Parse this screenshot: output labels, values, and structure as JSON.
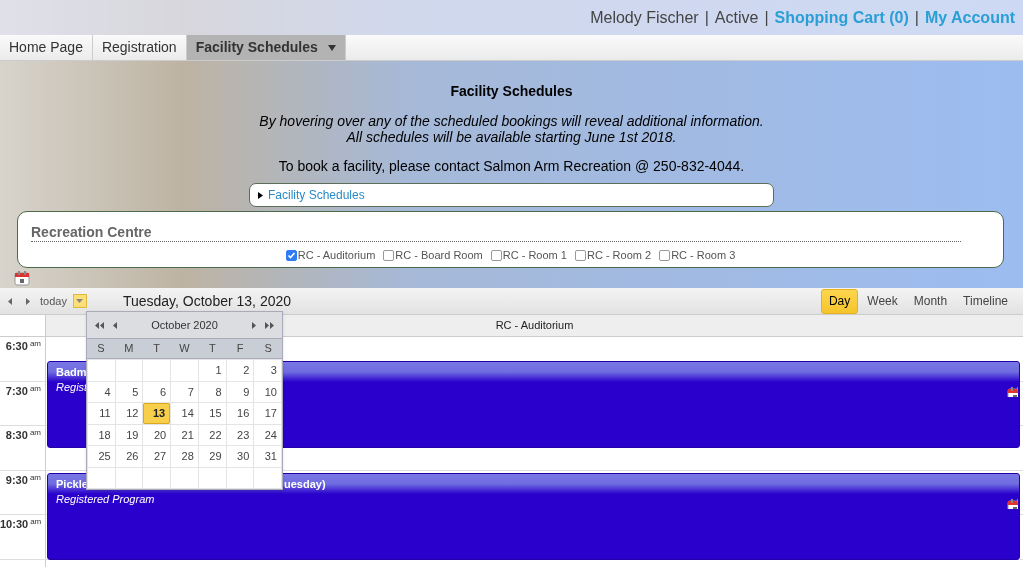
{
  "user_bar": {
    "name": "Melody Fischer",
    "status": "Active",
    "cart": "Shopping Cart (0)",
    "account": "My Account",
    "separator": "|"
  },
  "nav": [
    {
      "label": "Home Page",
      "selected": false,
      "dropdown": false
    },
    {
      "label": "Registration",
      "selected": false,
      "dropdown": false
    },
    {
      "label": "Facility Schedules",
      "selected": true,
      "dropdown": true
    }
  ],
  "intro": {
    "title": "Facility Schedules",
    "notes": [
      "By hovering over any of the scheduled bookings will reveal additional information.",
      "All schedules will be available starting June 1st 2018."
    ],
    "contact": "To book a facility, please contact Salmon Arm Recreation @ 250-832-4044.",
    "expander": {
      "label": "Facility Schedules",
      "expanded": false
    }
  },
  "facility_panel": {
    "title": "Recreation Centre",
    "rooms": [
      {
        "label": "RC - Auditorium",
        "checked": true
      },
      {
        "label": "RC - Board Room",
        "checked": false
      },
      {
        "label": "RC - Room 1",
        "checked": false
      },
      {
        "label": "RC - Room 2",
        "checked": false
      },
      {
        "label": "RC - Room 3",
        "checked": false
      }
    ]
  },
  "toolbar": {
    "today": "today",
    "date": "Tuesday, October 13, 2020",
    "views": [
      {
        "label": "Day",
        "selected": true
      },
      {
        "label": "Week",
        "selected": false
      },
      {
        "label": "Month",
        "selected": false
      },
      {
        "label": "Timeline",
        "selected": false
      }
    ]
  },
  "calendar": {
    "column": "RC - Auditorium",
    "times": [
      {
        "time": "6:30",
        "ampm": "am"
      },
      {
        "time": "7:30",
        "ampm": "am"
      },
      {
        "time": "8:30",
        "ampm": "am"
      },
      {
        "time": "9:30",
        "ampm": "am"
      },
      {
        "time": "10:30",
        "ampm": "am"
      }
    ],
    "events": [
      {
        "title": "Badm",
        "subtitle": "Regist"
      },
      {
        "title": "Pickle",
        "title_end": "uesday)",
        "subtitle": "Registered Program"
      }
    ]
  },
  "datepicker": {
    "month": "October 2020",
    "weekdays": [
      "S",
      "M",
      "T",
      "W",
      "T",
      "F",
      "S"
    ],
    "days": [
      {
        "selected": false
      },
      {
        "selected": false
      },
      {
        "selected": false
      },
      {
        "selected": false
      },
      {
        "day": "1",
        "selected": false
      },
      {
        "day": "2",
        "selected": false
      },
      {
        "day": "3",
        "selected": false
      },
      {
        "day": "4",
        "selected": false
      },
      {
        "day": "5",
        "selected": false
      },
      {
        "day": "6",
        "selected": false
      },
      {
        "day": "7",
        "selected": false
      },
      {
        "day": "8",
        "selected": false
      },
      {
        "day": "9",
        "selected": false
      },
      {
        "day": "10",
        "selected": false
      },
      {
        "day": "11",
        "selected": false
      },
      {
        "day": "12",
        "selected": false
      },
      {
        "day": "13",
        "selected": true
      },
      {
        "day": "14",
        "selected": false
      },
      {
        "day": "15",
        "selected": false
      },
      {
        "day": "16",
        "selected": false
      },
      {
        "day": "17",
        "selected": false
      },
      {
        "day": "18",
        "selected": false
      },
      {
        "day": "19",
        "selected": false
      },
      {
        "day": "20",
        "selected": false
      },
      {
        "day": "21",
        "selected": false
      },
      {
        "day": "22",
        "selected": false
      },
      {
        "day": "23",
        "selected": false
      },
      {
        "day": "24",
        "selected": false
      },
      {
        "day": "25",
        "selected": false
      },
      {
        "day": "26",
        "selected": false
      },
      {
        "day": "27",
        "selected": false
      },
      {
        "day": "28",
        "selected": false
      },
      {
        "day": "29",
        "selected": false
      },
      {
        "day": "30",
        "selected": false
      },
      {
        "day": "31",
        "selected": false
      },
      {
        "selected": false
      },
      {
        "selected": false
      },
      {
        "selected": false
      },
      {
        "selected": false
      },
      {
        "selected": false
      },
      {
        "selected": false
      },
      {
        "selected": false
      }
    ]
  }
}
